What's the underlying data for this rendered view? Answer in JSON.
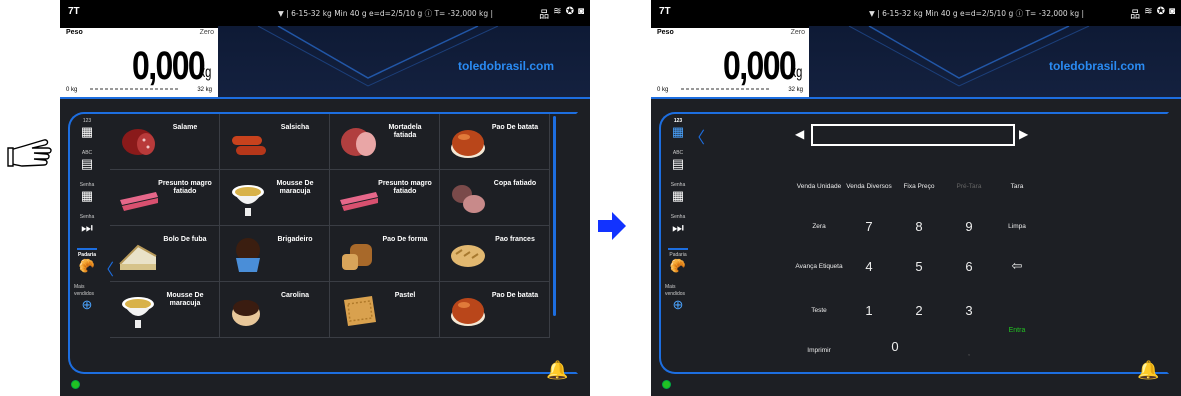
{
  "status": {
    "model": "7T",
    "specs": "▼ | 6-15-32 kg   Min 40 g   e=d=2/5/10 g   ⓘ T= -32,000 kg  |",
    "icons": [
      "network-icon",
      "wifi-icon",
      "settings-icon",
      "camera-icon"
    ]
  },
  "weight": {
    "label": "Peso",
    "zero_label": "Zero",
    "value": "0,000",
    "unit": "kg",
    "range_min": "0 kg",
    "range_max": "32 kg"
  },
  "banner": {
    "url": "toledobrasil.com"
  },
  "sidebar": {
    "items": [
      {
        "label": "123",
        "icon": "numeric-keypad-icon"
      },
      {
        "label": "ABC",
        "icon": "alpha-keyboard-icon"
      },
      {
        "label": "Senha",
        "icon": "password-keypad-icon"
      },
      {
        "label": "Senha",
        "icon": "skip-next-icon"
      },
      {
        "label": "Padaria",
        "icon": "bakery-icon"
      },
      {
        "label": "Mais vendidos",
        "icon": "best-sellers-icon"
      }
    ]
  },
  "products": [
    {
      "name": "Salame",
      "icon": "salami-icon"
    },
    {
      "name": "Salsicha",
      "icon": "sausage-icon"
    },
    {
      "name": "Mortadela fatiada",
      "icon": "mortadella-icon"
    },
    {
      "name": "Pao De batata",
      "icon": "bread-roll-icon"
    },
    {
      "name": "Presunto magro fatiado",
      "icon": "ham-slices-icon"
    },
    {
      "name": "Mousse De maracuja",
      "icon": "mousse-icon"
    },
    {
      "name": "Presunto magro fatiado",
      "icon": "ham-slices-icon"
    },
    {
      "name": "Copa fatiado",
      "icon": "cured-meat-icon"
    },
    {
      "name": "Bolo De fuba",
      "icon": "cake-icon"
    },
    {
      "name": "Brigadeiro",
      "icon": "brigadeiro-icon"
    },
    {
      "name": "Pao De forma",
      "icon": "loaf-icon"
    },
    {
      "name": "Pao frances",
      "icon": "french-bread-icon"
    },
    {
      "name": "Mousse De maracuja",
      "icon": "mousse-icon"
    },
    {
      "name": "Carolina",
      "icon": "carolina-icon"
    },
    {
      "name": "Pastel",
      "icon": "pastry-icon"
    },
    {
      "name": "Pao De batata",
      "icon": "bread-roll-icon"
    }
  ],
  "keypad": {
    "fn_row": [
      "Venda Unidade",
      "Venda Diversos",
      "Fixa Preço",
      "Pré-Tara",
      "Tara"
    ],
    "zera": "Zera",
    "limpa": "Limpa",
    "avanca": "Avança Etiqueta",
    "teste": "Teste",
    "imprimir": "Imprimir",
    "entra": "Entra",
    "digits": [
      "7",
      "8",
      "9",
      "4",
      "5",
      "6",
      "1",
      "2",
      "3",
      "0"
    ],
    "comma": ","
  },
  "colors": {
    "accent": "#1d6ee0",
    "ok": "#22c322",
    "bg": "#1d1f24"
  }
}
